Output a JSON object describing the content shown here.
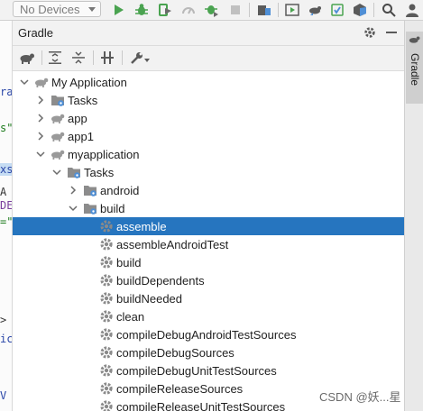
{
  "toolbar": {
    "device_selector": "No Devices",
    "icons": [
      "run-icon",
      "debug-icon",
      "apply-changes-icon",
      "profile-icon",
      "attach-debugger-icon",
      "stop-icon",
      "project-structure-icon",
      "avd-manager-icon",
      "sync-gradle-icon",
      "device-file-explorer-icon",
      "sdk-manager-icon",
      "search-icon",
      "user-icon"
    ]
  },
  "editor_fragments": [
    "rat",
    "s\":",
    "xse",
    "A",
    "DE",
    "=\"",
    ">",
    "ica",
    "V"
  ],
  "panel": {
    "title": "Gradle",
    "side_tab_label": "Gradle",
    "tree": [
      {
        "label": "My Application",
        "depth": 0,
        "expanded": true,
        "icon": "elephant-icon"
      },
      {
        "label": "Tasks",
        "depth": 1,
        "expanded": false,
        "icon": "tasks-folder-icon"
      },
      {
        "label": "app",
        "depth": 1,
        "expanded": false,
        "icon": "elephant-icon"
      },
      {
        "label": "app1",
        "depth": 1,
        "expanded": false,
        "icon": "elephant-icon"
      },
      {
        "label": "myapplication",
        "depth": 1,
        "expanded": true,
        "icon": "elephant-icon"
      },
      {
        "label": "Tasks",
        "depth": 2,
        "expanded": true,
        "icon": "tasks-folder-icon"
      },
      {
        "label": "android",
        "depth": 3,
        "expanded": false,
        "icon": "tasks-folder-icon"
      },
      {
        "label": "build",
        "depth": 3,
        "expanded": true,
        "icon": "tasks-folder-icon"
      },
      {
        "label": "assemble",
        "depth": 4,
        "icon": "gear-icon",
        "selected": true
      },
      {
        "label": "assembleAndroidTest",
        "depth": 4,
        "icon": "gear-icon"
      },
      {
        "label": "build",
        "depth": 4,
        "icon": "gear-icon"
      },
      {
        "label": "buildDependents",
        "depth": 4,
        "icon": "gear-icon"
      },
      {
        "label": "buildNeeded",
        "depth": 4,
        "icon": "gear-icon"
      },
      {
        "label": "clean",
        "depth": 4,
        "icon": "gear-icon"
      },
      {
        "label": "compileDebugAndroidTestSources",
        "depth": 4,
        "icon": "gear-icon"
      },
      {
        "label": "compileDebugSources",
        "depth": 4,
        "icon": "gear-icon"
      },
      {
        "label": "compileDebugUnitTestSources",
        "depth": 4,
        "icon": "gear-icon"
      },
      {
        "label": "compileReleaseSources",
        "depth": 4,
        "icon": "gear-icon"
      },
      {
        "label": "compileReleaseUnitTestSources",
        "depth": 4,
        "icon": "gear-icon"
      }
    ]
  },
  "watermark": "CSDN @妖...星",
  "colors": {
    "selection": "#2675bf",
    "run_green": "#4aa350",
    "folder_blue": "#4f8fd6"
  }
}
